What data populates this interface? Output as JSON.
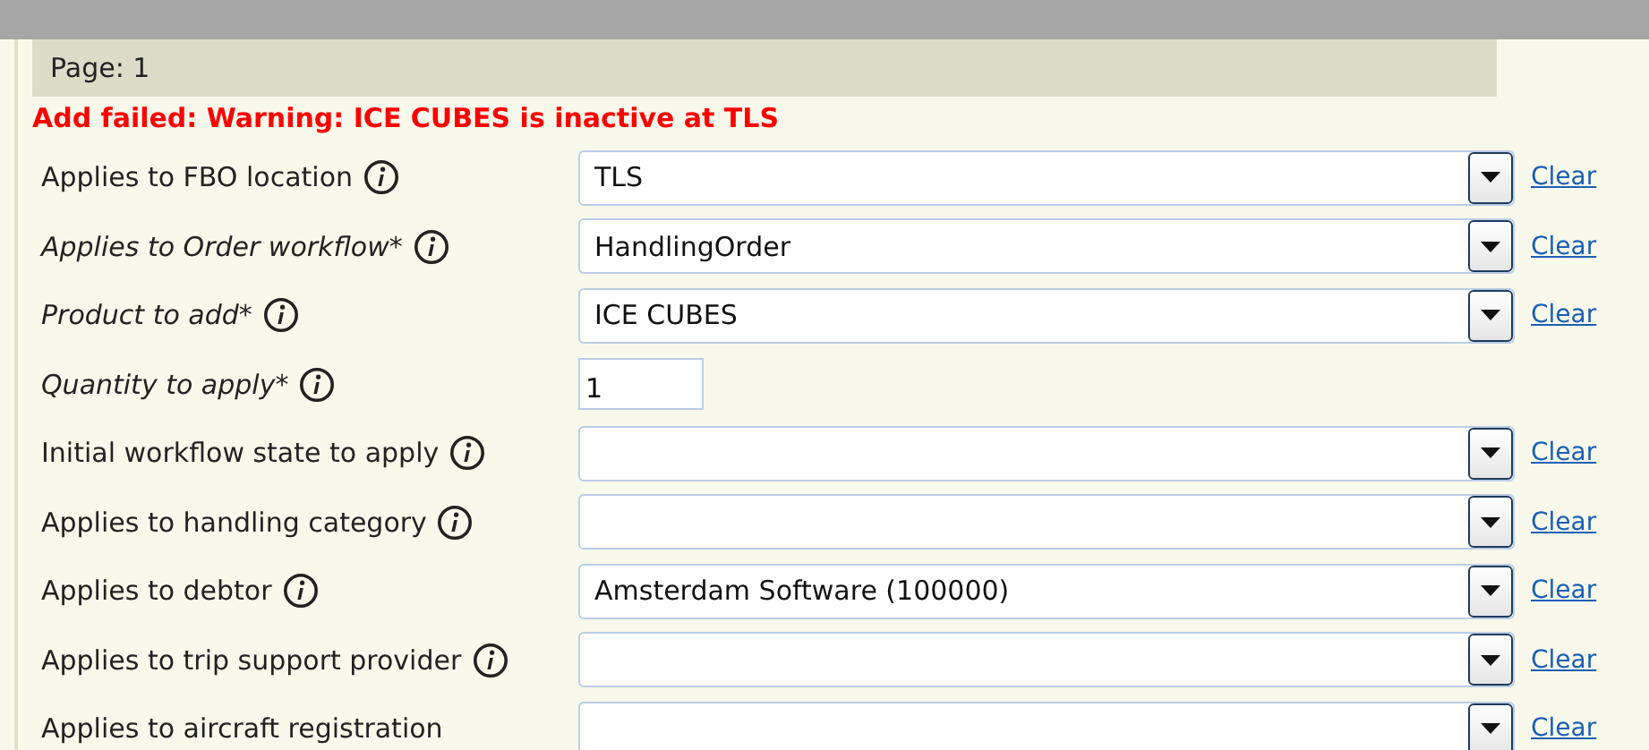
{
  "page_bar": {
    "label": "Page: 1"
  },
  "error": "Add failed: Warning: ICE CUBES is inactive at TLS",
  "fields": [
    {
      "label": "Applies to FBO location",
      "required": false,
      "info": true,
      "kind": "select",
      "value": "TLS",
      "clear": "Clear"
    },
    {
      "label": "Applies to Order workflow*",
      "required": true,
      "info": true,
      "kind": "select",
      "value": "HandlingOrder",
      "clear": "Clear"
    },
    {
      "label": "Product to add*",
      "required": true,
      "info": true,
      "kind": "select",
      "value": "ICE CUBES",
      "clear": "Clear"
    },
    {
      "label": "Quantity to apply*",
      "required": true,
      "info": true,
      "kind": "number",
      "value": "1"
    },
    {
      "label": "Initial workflow state to apply",
      "required": false,
      "info": true,
      "kind": "select",
      "clear": "Clear"
    },
    {
      "label": "Applies to handling category",
      "required": false,
      "info": true,
      "kind": "select",
      "clear": "Clear"
    },
    {
      "label": "Applies to debtor",
      "required": false,
      "info": true,
      "kind": "select",
      "value": "Amsterdam Software (100000)",
      "clear": "Clear"
    },
    {
      "label": "Applies to trip support provider",
      "required": false,
      "info": true,
      "kind": "select",
      "clear": "Clear"
    },
    {
      "label": "Applies to aircraft registration",
      "required": false,
      "info": false,
      "kind": "select",
      "clear": "Clear"
    }
  ]
}
